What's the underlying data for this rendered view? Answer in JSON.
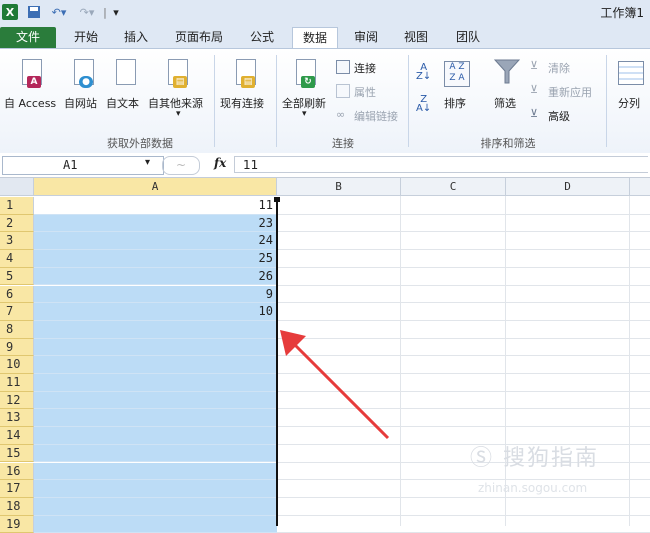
{
  "window": {
    "title": "工作簿1"
  },
  "quick_access": {
    "separator": "|"
  },
  "tabs": [
    {
      "label": "文件",
      "active": false
    },
    {
      "label": "开始",
      "active": false
    },
    {
      "label": "插入",
      "active": false
    },
    {
      "label": "页面布局",
      "active": false
    },
    {
      "label": "公式",
      "active": false
    },
    {
      "label": "数据",
      "active": true
    },
    {
      "label": "审阅",
      "active": false
    },
    {
      "label": "视图",
      "active": false
    },
    {
      "label": "团队",
      "active": false
    }
  ],
  "ribbon": {
    "external_data": {
      "group_label": "获取外部数据",
      "buttons": [
        "自 Access",
        "自网站",
        "自文本",
        "自其他来源",
        "现有连接"
      ]
    },
    "connections": {
      "group_label": "连接",
      "refresh_all": "全部刷新",
      "connections": "连接",
      "properties": "属性",
      "edit_links": "编辑链接"
    },
    "sort_filter": {
      "group_label": "排序和筛选",
      "sort": "排序",
      "filter": "筛选",
      "clear": "清除",
      "reapply": "重新应用",
      "advanced": "高级"
    },
    "data_tools": {
      "split": "分列"
    }
  },
  "formula_bar": {
    "name_box": "A1",
    "fx": "fx",
    "value": "11"
  },
  "grid": {
    "columns": [
      "A",
      "B",
      "C",
      "D"
    ],
    "rows": [
      "1",
      "2",
      "3",
      "4",
      "5",
      "6",
      "7",
      "8",
      "9",
      "10",
      "11",
      "12",
      "13",
      "14",
      "15",
      "16",
      "17",
      "18",
      "19"
    ],
    "column_a_values": [
      "11",
      "23",
      "24",
      "25",
      "26",
      "9",
      "10",
      "",
      "",
      "",
      "",
      "",
      "",
      "",
      "",
      "",
      "",
      "",
      ""
    ]
  },
  "colors": {
    "file_tab": "#2a7c3b",
    "selection": "#bcdcf6",
    "row_header_selected": "#f9e7a5",
    "arrow": "#e63b3b"
  }
}
